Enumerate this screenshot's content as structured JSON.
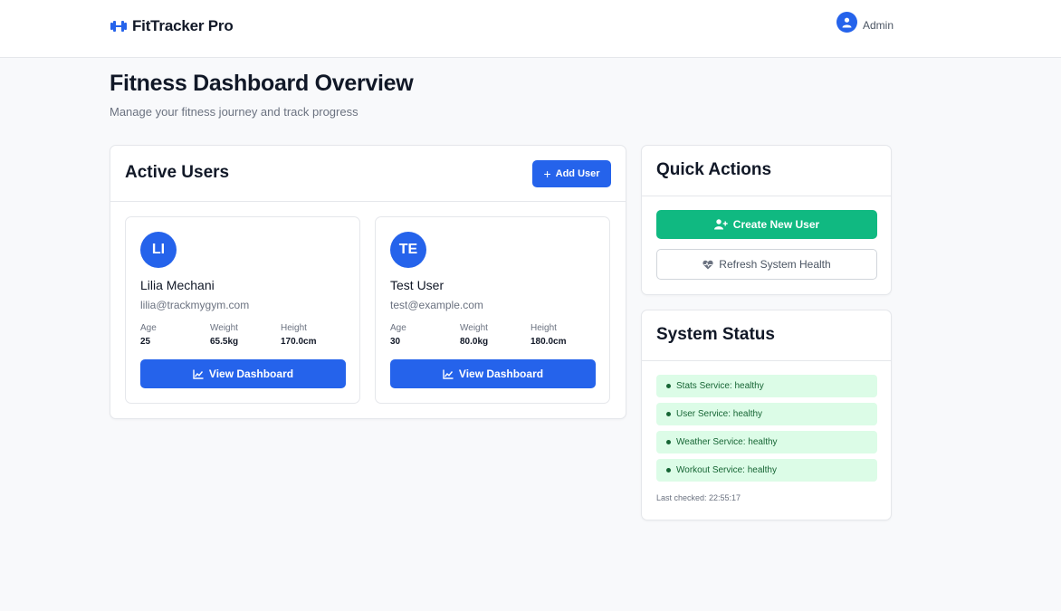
{
  "app": {
    "name": "FitTracker Pro"
  },
  "header": {
    "user_label": "Admin"
  },
  "page": {
    "title": "Fitness Dashboard Overview",
    "subtitle": "Manage your fitness journey and track progress"
  },
  "users_panel": {
    "title": "Active Users",
    "add_button": "Add User",
    "users": [
      {
        "initials": "LI",
        "name": "Lilia Mechani",
        "email": "lilia@trackmygym.com",
        "age": "25",
        "weight": "65.5kg",
        "height": "170.0cm",
        "button": "View Dashboard"
      },
      {
        "initials": "TE",
        "name": "Test User",
        "email": "test@example.com",
        "age": "30",
        "weight": "80.0kg",
        "height": "180.0cm",
        "button": "View Dashboard"
      }
    ],
    "stat_labels": {
      "age": "Age",
      "weight": "Weight",
      "height": "Height"
    }
  },
  "quick_actions": {
    "title": "Quick Actions",
    "create_button": "Create New User",
    "refresh_button": "Refresh System Health"
  },
  "system_status": {
    "title": "System Status",
    "services": [
      "Stats Service: healthy",
      "User Service: healthy",
      "Weather Service: healthy",
      "Workout Service: healthy"
    ],
    "last_checked": "Last checked: 22:55:17"
  },
  "colors": {
    "primary": "#2563eb",
    "success": "#10b981",
    "healthy_bg": "#dcfce7",
    "healthy_text": "#166534",
    "page_bg": "#f8f9fb"
  },
  "icons": {
    "brand": "dumbbell-icon",
    "user": "user-circle-icon",
    "add": "plus-icon",
    "chart": "chart-line-icon",
    "add_user": "user-plus-icon",
    "health": "heartbeat-icon",
    "status": "status-dot-icon"
  }
}
